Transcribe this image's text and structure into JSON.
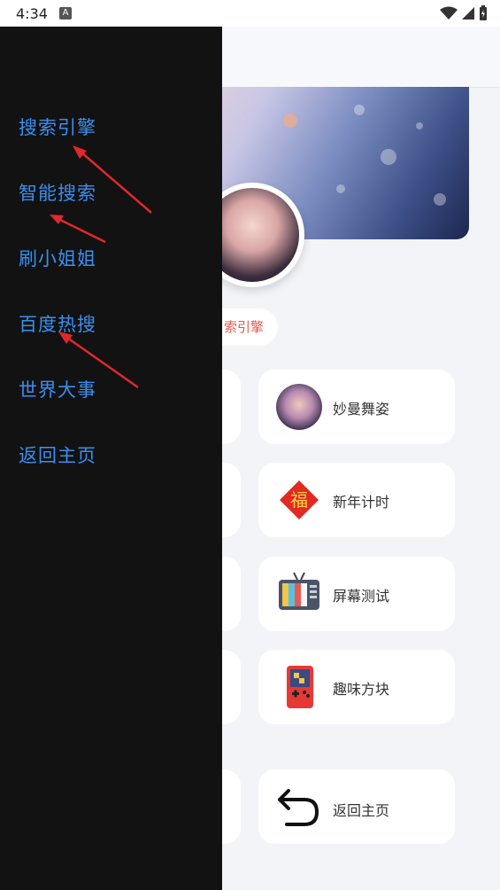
{
  "status_bar": {
    "time": "4:34",
    "notif_letter": "A"
  },
  "profile": {
    "chip_label": "索引擎"
  },
  "cards": [
    {
      "label": "妙曼舞姿",
      "icon": "dancer-avatar-icon"
    },
    {
      "label": "新年计时",
      "icon": "fu-diamond-icon"
    },
    {
      "label": "屏幕测试",
      "icon": "tv-test-icon"
    },
    {
      "label": "趣味方块",
      "icon": "game-console-icon"
    },
    {
      "label": "返回主页",
      "icon": "return-arrow-icon"
    }
  ],
  "drawer": {
    "items": [
      {
        "label": "搜索引擎"
      },
      {
        "label": "智能搜索"
      },
      {
        "label": "刷小姐姐"
      },
      {
        "label": "百度热搜"
      },
      {
        "label": "世界大事"
      },
      {
        "label": "返回主页"
      }
    ]
  },
  "colors": {
    "drawer_bg": "#121212",
    "menu_text": "#3a8ff0",
    "annotation_arrow": "#e0282d",
    "chip_text": "#e05a4e"
  }
}
